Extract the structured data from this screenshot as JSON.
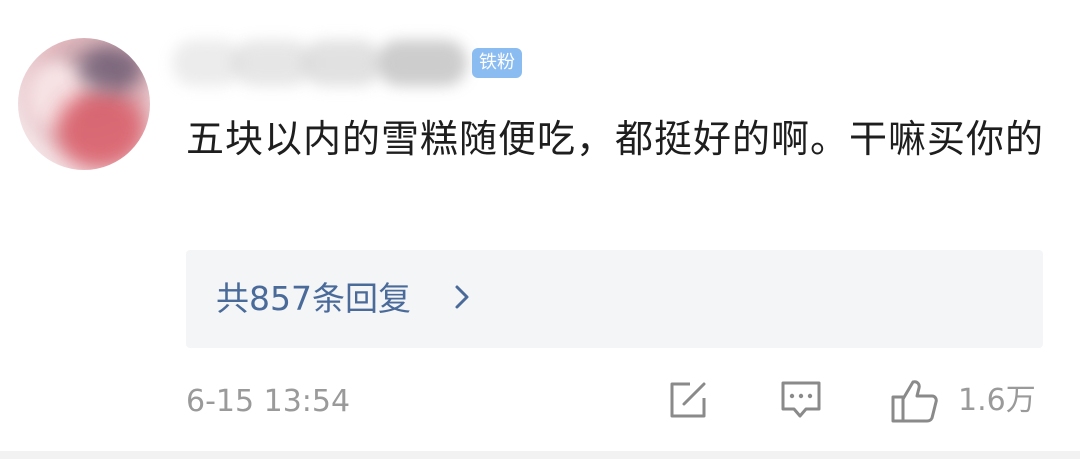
{
  "user": {
    "badge": "铁粉"
  },
  "comment": {
    "text": "五块以内的雪糕随便吃，都挺好的啊。干嘛买你的",
    "replies_link": "共857条回复"
  },
  "meta": {
    "timestamp": "6-15 13:54",
    "like_count": "1.6万"
  },
  "icons": {
    "edit": "edit-icon",
    "reply": "comment-icon",
    "like": "thumbs-up-icon",
    "chevron": "chevron-right-icon"
  },
  "colors": {
    "link": "#4a6b9a",
    "badge": "#8bbcf1",
    "secondary_text": "#9a9a9a"
  }
}
